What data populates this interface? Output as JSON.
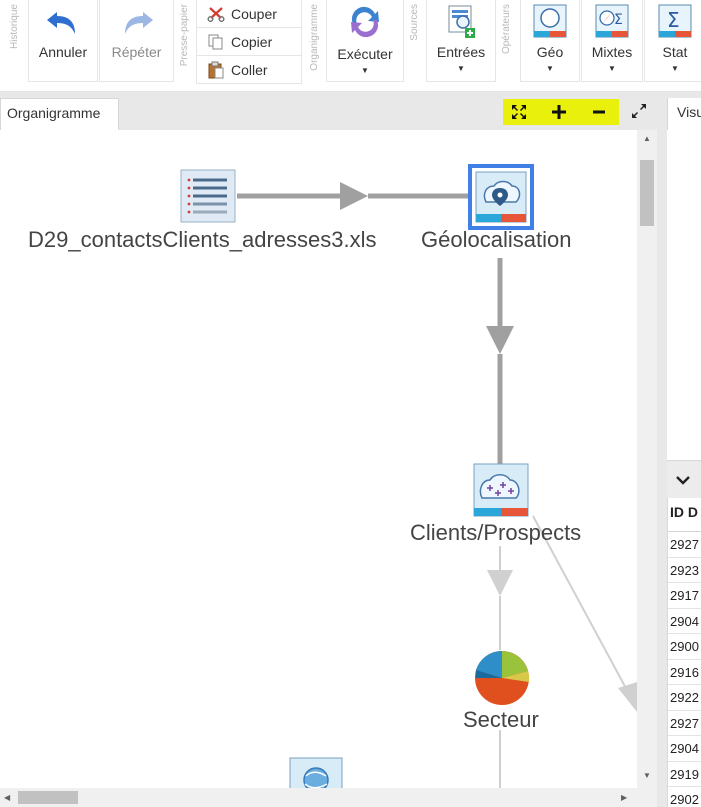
{
  "ribbon": {
    "groups": {
      "history": "Historique",
      "clipboard": "Presse-papier",
      "orgchart": "Organigramme",
      "sources": "Sources",
      "operators": "Opérateurs"
    },
    "undo": "Annuler",
    "redo": "Répéter",
    "cut": "Couper",
    "copy": "Copier",
    "paste": "Coller",
    "execute": "Exécuter",
    "inputs": "Entrées",
    "geo": "Géo",
    "mixed": "Mixtes",
    "stat": "Stat"
  },
  "tabs": {
    "orgchart": "Organigramme",
    "visu": "Visu"
  },
  "nodes": {
    "source": "D29_contactsClients_adresses3.xls",
    "geoloc": "Géolocalisation",
    "clients": "Clients/Prospects",
    "sector": "Secteur"
  },
  "table": {
    "header": "ID D",
    "rows": [
      "2927",
      "2923",
      "2917",
      "2904",
      "2900",
      "2916",
      "2922",
      "2927",
      "2904",
      "2919",
      "2902"
    ]
  },
  "colors": {
    "highlight": "#e8f00c",
    "selection": "#3f7fe6",
    "accent_blue": "#2aa6d8",
    "accent_red": "#e8563a"
  }
}
